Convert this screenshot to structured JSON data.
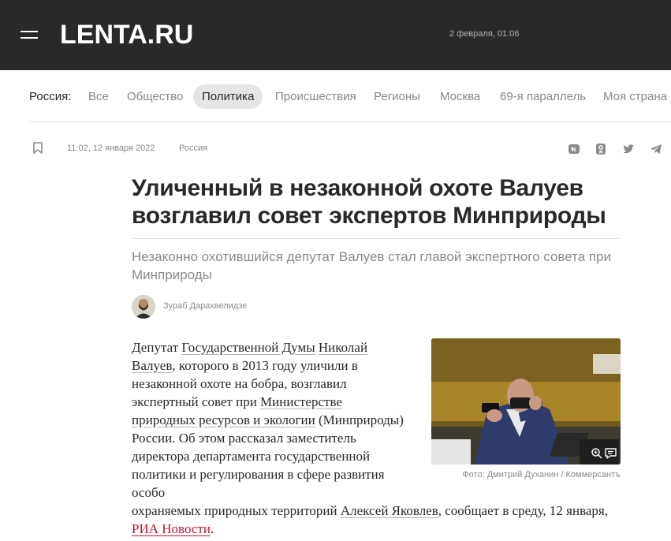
{
  "header": {
    "logo": "LENTA.RU",
    "date": "2 февраля, 01:06"
  },
  "icons": {
    "menu": "hamburger-menu-icon",
    "bookmark": "bookmark-icon",
    "share": [
      "vk-icon",
      "odnoklassniki-icon",
      "twitter-icon",
      "telegram-icon"
    ],
    "zoom": "zoom-in-icon",
    "comments": "comments-icon"
  },
  "rubrics": {
    "label": "Россия:",
    "items": [
      "Все",
      "Общество",
      "Политика",
      "Происшествия",
      "Регионы",
      "Москва",
      "69-я параллель",
      "Моя страна"
    ],
    "active": "Политика"
  },
  "article": {
    "time": "11:02, 12 января 2022",
    "rubric": "Россия",
    "title": "Уличенный в незаконной охоте Валуев возглавил совет экспертов Минприроды",
    "lead": "Незаконно охотившийся депутат Валуев стал главой экспертного совета при Минприроды",
    "author": "Зураб Дарахвелидзе",
    "photo_caption": "Фото: Дмитрий Духанин / Коммерсантъ",
    "body": {
      "t1": "Депутат ",
      "link1": "Государственной Думы",
      "t2": " ",
      "link2": "Николай Валуев",
      "t3": ", которого в 2013 году уличили в незаконной охоте на бобра, возглавил экспертный совет при ",
      "link3": "Министерстве природных ресурсов и экологии",
      "t4": " (Минприроды) России. Об этом рассказал заместитель директора департамента государственной политики и регулирования в сфере развития особо охраняемых природных территорий ",
      "link4": "Алексей Яковлев",
      "t5": ", сообщает в среду, 12 января, ",
      "link5": "РИА Новости",
      "t6": "."
    }
  },
  "colors": {
    "header_bg": "#292929",
    "accent_link": "#c0162a",
    "active_pill": "#e5e5e5"
  }
}
